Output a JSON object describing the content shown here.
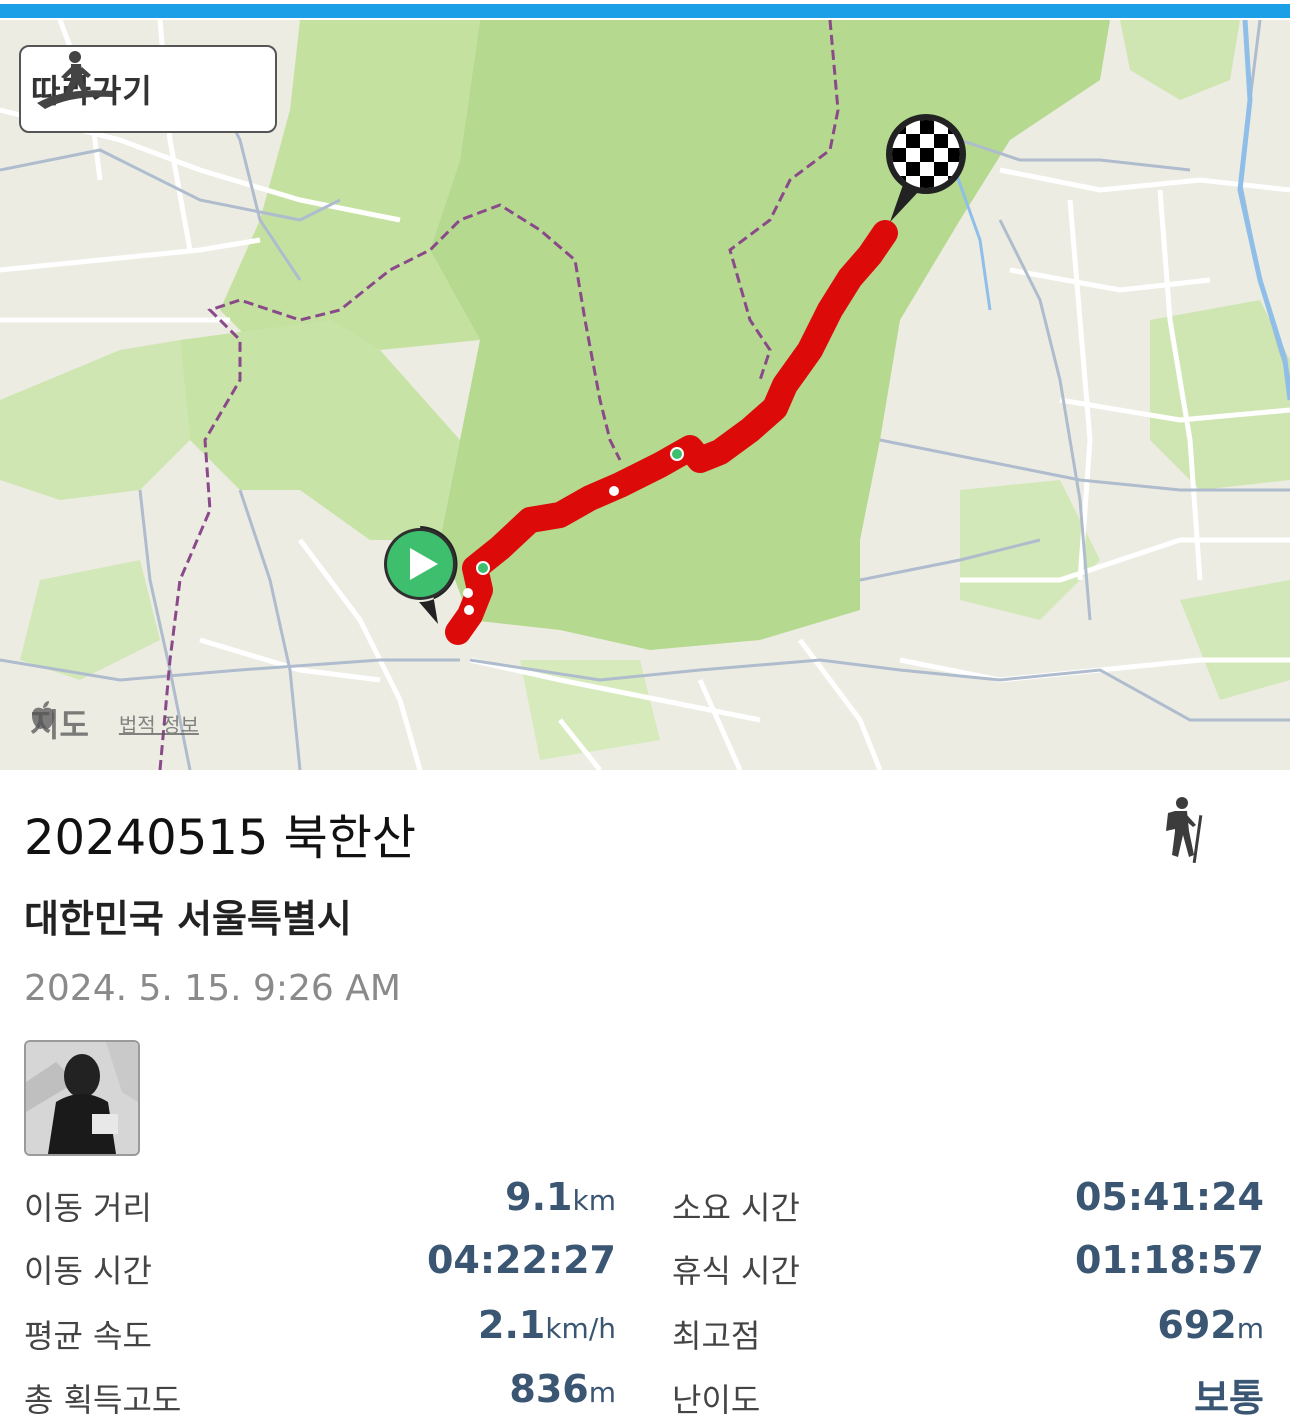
{
  "map": {
    "follow_label": "따라가기",
    "attribution_brand": "지도",
    "attribution_legal": "법적 정보"
  },
  "activity": {
    "title": "20240515 북한산",
    "location": "대한민국 서울특별시",
    "datetime": "2024. 5. 15. 9:26 AM"
  },
  "stats": {
    "distance": {
      "label": "이동 거리",
      "value": "9.1",
      "unit": "km"
    },
    "total_time": {
      "label": "소요 시간",
      "value": "05:41:24",
      "unit": ""
    },
    "moving_time": {
      "label": "이동 시간",
      "value": "04:22:27",
      "unit": ""
    },
    "rest_time": {
      "label": "휴식 시간",
      "value": "01:18:57",
      "unit": ""
    },
    "avg_speed": {
      "label": "평균 속도",
      "value": "2.1",
      "unit": "km/h"
    },
    "max_altitude": {
      "label": "최고점",
      "value": "692",
      "unit": "m"
    },
    "elevation_gain": {
      "label": "총 획득고도",
      "value": "836",
      "unit": "m"
    },
    "difficulty": {
      "label": "난이도",
      "value": "보통",
      "unit": ""
    }
  },
  "colors": {
    "accent": "#1ba0e8",
    "route": "#dd0a0a",
    "start_marker": "#3dbf6e",
    "stat_value": "#3a5673"
  },
  "icons": {
    "follow": "hiker-on-path-icon",
    "activity_type": "hiking-icon",
    "start": "play-icon",
    "finish": "checkered-flag-icon"
  }
}
